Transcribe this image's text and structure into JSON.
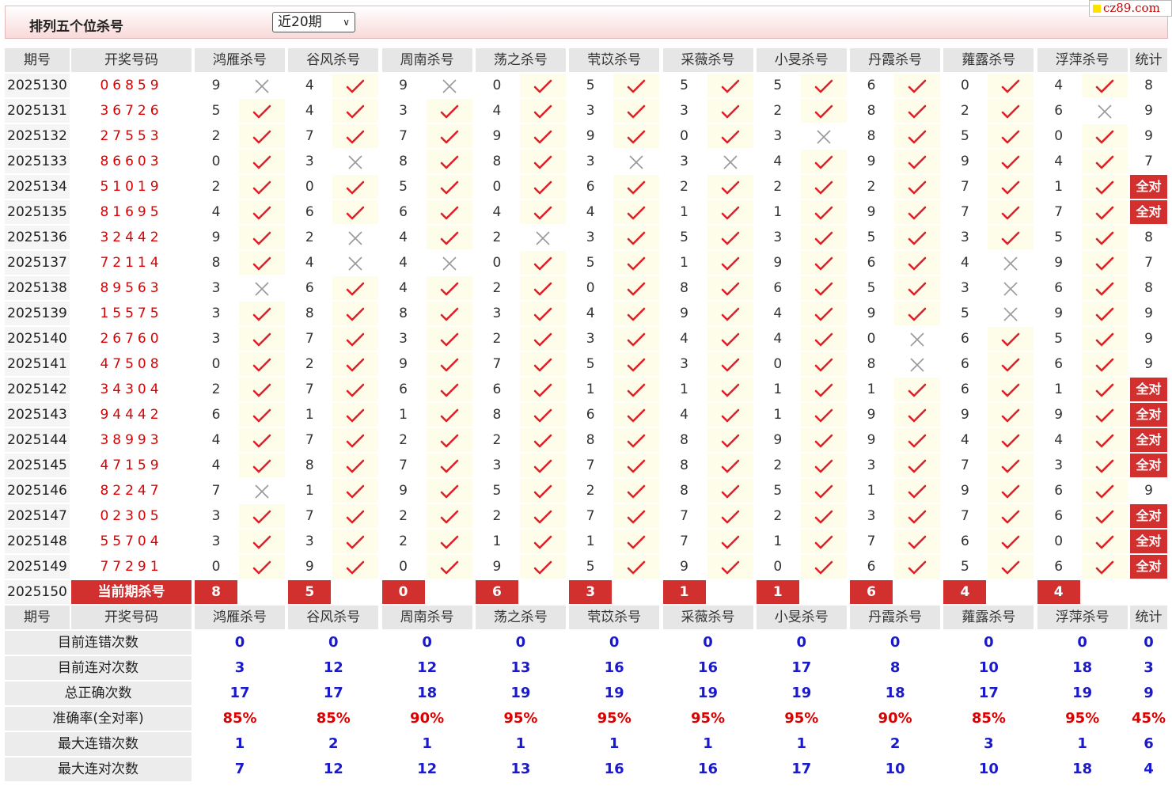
{
  "title": "排列五个位杀号",
  "period_select": "近20期",
  "brand": "cz89.com",
  "colors": {
    "red": "#d22f2f",
    "blue": "#1a1acc",
    "check": "#e0202a",
    "cross": "#999999"
  },
  "icons": {
    "hit": "check-mark-icon",
    "miss": "cross-mark-icon",
    "select": "chevron-down-icon"
  },
  "headers": [
    "期号",
    "开奖号码",
    "鸿雁杀号",
    "谷风杀号",
    "周南杀号",
    "荡之杀号",
    "茕苡杀号",
    "采薇杀号",
    "小旻杀号",
    "丹霞杀号",
    "蕹露杀号",
    "浮萍杀号",
    "统计"
  ],
  "rows": [
    {
      "p": "2025130",
      "w": "06859",
      "k": [
        [
          "9",
          0
        ],
        [
          "4",
          1
        ],
        [
          "9",
          0
        ],
        [
          "0",
          1
        ],
        [
          "5",
          1
        ],
        [
          "5",
          1
        ],
        [
          "5",
          1
        ],
        [
          "6",
          1
        ],
        [
          "0",
          1
        ],
        [
          "4",
          1
        ]
      ],
      "s": "8"
    },
    {
      "p": "2025131",
      "w": "36726",
      "k": [
        [
          "5",
          1
        ],
        [
          "4",
          1
        ],
        [
          "3",
          1
        ],
        [
          "4",
          1
        ],
        [
          "3",
          1
        ],
        [
          "3",
          1
        ],
        [
          "2",
          1
        ],
        [
          "8",
          1
        ],
        [
          "2",
          1
        ],
        [
          "6",
          0
        ]
      ],
      "s": "9"
    },
    {
      "p": "2025132",
      "w": "27553",
      "k": [
        [
          "2",
          1
        ],
        [
          "7",
          1
        ],
        [
          "7",
          1
        ],
        [
          "9",
          1
        ],
        [
          "9",
          1
        ],
        [
          "0",
          1
        ],
        [
          "3",
          0
        ],
        [
          "8",
          1
        ],
        [
          "5",
          1
        ],
        [
          "0",
          1
        ]
      ],
      "s": "9"
    },
    {
      "p": "2025133",
      "w": "86603",
      "k": [
        [
          "0",
          1
        ],
        [
          "3",
          0
        ],
        [
          "8",
          1
        ],
        [
          "8",
          1
        ],
        [
          "3",
          0
        ],
        [
          "3",
          0
        ],
        [
          "4",
          1
        ],
        [
          "9",
          1
        ],
        [
          "9",
          1
        ],
        [
          "4",
          1
        ]
      ],
      "s": "7"
    },
    {
      "p": "2025134",
      "w": "51019",
      "k": [
        [
          "2",
          1
        ],
        [
          "0",
          1
        ],
        [
          "5",
          1
        ],
        [
          "0",
          1
        ],
        [
          "6",
          1
        ],
        [
          "2",
          1
        ],
        [
          "2",
          1
        ],
        [
          "2",
          1
        ],
        [
          "7",
          1
        ],
        [
          "1",
          1
        ]
      ],
      "s": "全对"
    },
    {
      "p": "2025135",
      "w": "81695",
      "k": [
        [
          "4",
          1
        ],
        [
          "6",
          1
        ],
        [
          "6",
          1
        ],
        [
          "4",
          1
        ],
        [
          "4",
          1
        ],
        [
          "1",
          1
        ],
        [
          "1",
          1
        ],
        [
          "9",
          1
        ],
        [
          "7",
          1
        ],
        [
          "7",
          1
        ]
      ],
      "s": "全对"
    },
    {
      "p": "2025136",
      "w": "32442",
      "k": [
        [
          "9",
          1
        ],
        [
          "2",
          0
        ],
        [
          "4",
          1
        ],
        [
          "2",
          0
        ],
        [
          "3",
          1
        ],
        [
          "5",
          1
        ],
        [
          "3",
          1
        ],
        [
          "5",
          1
        ],
        [
          "3",
          1
        ],
        [
          "5",
          1
        ]
      ],
      "s": "8"
    },
    {
      "p": "2025137",
      "w": "72114",
      "k": [
        [
          "8",
          1
        ],
        [
          "4",
          0
        ],
        [
          "4",
          0
        ],
        [
          "0",
          1
        ],
        [
          "5",
          1
        ],
        [
          "1",
          1
        ],
        [
          "9",
          1
        ],
        [
          "6",
          1
        ],
        [
          "4",
          0
        ],
        [
          "9",
          1
        ]
      ],
      "s": "7"
    },
    {
      "p": "2025138",
      "w": "89563",
      "k": [
        [
          "3",
          0
        ],
        [
          "6",
          1
        ],
        [
          "4",
          1
        ],
        [
          "2",
          1
        ],
        [
          "0",
          1
        ],
        [
          "8",
          1
        ],
        [
          "6",
          1
        ],
        [
          "5",
          1
        ],
        [
          "3",
          0
        ],
        [
          "6",
          1
        ]
      ],
      "s": "8"
    },
    {
      "p": "2025139",
      "w": "15575",
      "k": [
        [
          "3",
          1
        ],
        [
          "8",
          1
        ],
        [
          "8",
          1
        ],
        [
          "3",
          1
        ],
        [
          "4",
          1
        ],
        [
          "9",
          1
        ],
        [
          "4",
          1
        ],
        [
          "9",
          1
        ],
        [
          "5",
          0
        ],
        [
          "9",
          1
        ]
      ],
      "s": "9"
    },
    {
      "p": "2025140",
      "w": "26760",
      "k": [
        [
          "3",
          1
        ],
        [
          "7",
          1
        ],
        [
          "3",
          1
        ],
        [
          "2",
          1
        ],
        [
          "3",
          1
        ],
        [
          "4",
          1
        ],
        [
          "4",
          1
        ],
        [
          "0",
          0
        ],
        [
          "6",
          1
        ],
        [
          "5",
          1
        ]
      ],
      "s": "9"
    },
    {
      "p": "2025141",
      "w": "47508",
      "k": [
        [
          "0",
          1
        ],
        [
          "2",
          1
        ],
        [
          "9",
          1
        ],
        [
          "7",
          1
        ],
        [
          "5",
          1
        ],
        [
          "3",
          1
        ],
        [
          "0",
          1
        ],
        [
          "8",
          0
        ],
        [
          "6",
          1
        ],
        [
          "6",
          1
        ]
      ],
      "s": "9"
    },
    {
      "p": "2025142",
      "w": "34304",
      "k": [
        [
          "2",
          1
        ],
        [
          "7",
          1
        ],
        [
          "6",
          1
        ],
        [
          "6",
          1
        ],
        [
          "1",
          1
        ],
        [
          "1",
          1
        ],
        [
          "1",
          1
        ],
        [
          "1",
          1
        ],
        [
          "6",
          1
        ],
        [
          "1",
          1
        ]
      ],
      "s": "全对"
    },
    {
      "p": "2025143",
      "w": "94442",
      "k": [
        [
          "6",
          1
        ],
        [
          "1",
          1
        ],
        [
          "1",
          1
        ],
        [
          "8",
          1
        ],
        [
          "6",
          1
        ],
        [
          "4",
          1
        ],
        [
          "1",
          1
        ],
        [
          "9",
          1
        ],
        [
          "9",
          1
        ],
        [
          "9",
          1
        ]
      ],
      "s": "全对"
    },
    {
      "p": "2025144",
      "w": "38993",
      "k": [
        [
          "4",
          1
        ],
        [
          "7",
          1
        ],
        [
          "2",
          1
        ],
        [
          "2",
          1
        ],
        [
          "8",
          1
        ],
        [
          "8",
          1
        ],
        [
          "9",
          1
        ],
        [
          "9",
          1
        ],
        [
          "4",
          1
        ],
        [
          "4",
          1
        ]
      ],
      "s": "全对"
    },
    {
      "p": "2025145",
      "w": "47159",
      "k": [
        [
          "4",
          1
        ],
        [
          "8",
          1
        ],
        [
          "7",
          1
        ],
        [
          "3",
          1
        ],
        [
          "7",
          1
        ],
        [
          "8",
          1
        ],
        [
          "2",
          1
        ],
        [
          "3",
          1
        ],
        [
          "7",
          1
        ],
        [
          "3",
          1
        ]
      ],
      "s": "全对"
    },
    {
      "p": "2025146",
      "w": "82247",
      "k": [
        [
          "7",
          0
        ],
        [
          "1",
          1
        ],
        [
          "9",
          1
        ],
        [
          "5",
          1
        ],
        [
          "2",
          1
        ],
        [
          "8",
          1
        ],
        [
          "5",
          1
        ],
        [
          "1",
          1
        ],
        [
          "9",
          1
        ],
        [
          "6",
          1
        ]
      ],
      "s": "9"
    },
    {
      "p": "2025147",
      "w": "02305",
      "k": [
        [
          "3",
          1
        ],
        [
          "7",
          1
        ],
        [
          "2",
          1
        ],
        [
          "2",
          1
        ],
        [
          "7",
          1
        ],
        [
          "7",
          1
        ],
        [
          "2",
          1
        ],
        [
          "3",
          1
        ],
        [
          "7",
          1
        ],
        [
          "6",
          1
        ]
      ],
      "s": "全对"
    },
    {
      "p": "2025148",
      "w": "55704",
      "k": [
        [
          "3",
          1
        ],
        [
          "3",
          1
        ],
        [
          "2",
          1
        ],
        [
          "1",
          1
        ],
        [
          "1",
          1
        ],
        [
          "7",
          1
        ],
        [
          "1",
          1
        ],
        [
          "7",
          1
        ],
        [
          "6",
          1
        ],
        [
          "0",
          1
        ]
      ],
      "s": "全对"
    },
    {
      "p": "2025149",
      "w": "77291",
      "k": [
        [
          "0",
          1
        ],
        [
          "9",
          1
        ],
        [
          "0",
          1
        ],
        [
          "9",
          1
        ],
        [
          "5",
          1
        ],
        [
          "9",
          1
        ],
        [
          "0",
          1
        ],
        [
          "6",
          1
        ],
        [
          "5",
          1
        ],
        [
          "6",
          1
        ]
      ],
      "s": "全对"
    }
  ],
  "current": {
    "p": "2025150",
    "label": "当前期杀号",
    "k": [
      "8",
      "5",
      "0",
      "6",
      "3",
      "1",
      "1",
      "6",
      "4",
      "4"
    ]
  },
  "stats": [
    {
      "label": "目前连错次数",
      "v": [
        "0",
        "0",
        "0",
        "0",
        "0",
        "0",
        "0",
        "0",
        "0",
        "0",
        "0"
      ],
      "red": false
    },
    {
      "label": "目前连对次数",
      "v": [
        "3",
        "12",
        "12",
        "13",
        "16",
        "16",
        "17",
        "8",
        "10",
        "18",
        "3"
      ],
      "red": false
    },
    {
      "label": "总正确次数",
      "v": [
        "17",
        "17",
        "18",
        "19",
        "19",
        "19",
        "19",
        "18",
        "17",
        "19",
        "9"
      ],
      "red": false
    },
    {
      "label": "准确率(全对率)",
      "v": [
        "85%",
        "85%",
        "90%",
        "95%",
        "95%",
        "95%",
        "95%",
        "90%",
        "85%",
        "95%",
        "45%"
      ],
      "red": true
    },
    {
      "label": "最大连错次数",
      "v": [
        "1",
        "2",
        "1",
        "1",
        "1",
        "1",
        "1",
        "2",
        "3",
        "1",
        "6"
      ],
      "red": false
    },
    {
      "label": "最大连对次数",
      "v": [
        "7",
        "12",
        "12",
        "13",
        "16",
        "16",
        "17",
        "10",
        "10",
        "18",
        "4"
      ],
      "red": false
    }
  ]
}
